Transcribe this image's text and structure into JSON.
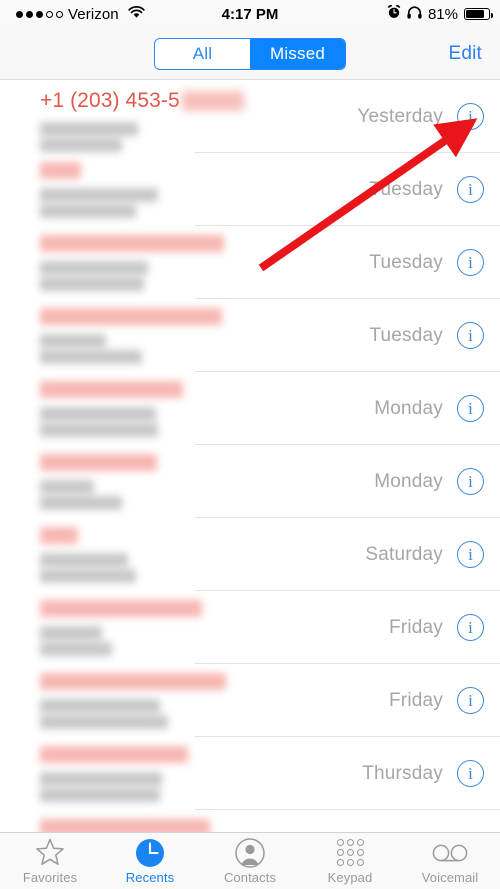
{
  "status_bar": {
    "carrier": "Verizon",
    "signal_dots_filled": 3,
    "signal_dots_total": 5,
    "wifi_icon": "wifi-icon",
    "time": "4:17 PM",
    "alarm_icon": "alarm-clock-icon",
    "headphones_icon": "headphones-icon",
    "battery_percent": "81%",
    "battery_level": 81
  },
  "nav_bar": {
    "segments": [
      {
        "label": "All",
        "selected": false
      },
      {
        "label": "Missed",
        "selected": true
      }
    ],
    "edit_label": "Edit"
  },
  "colors": {
    "accent_blue": "#0b84fe",
    "tint_blue": "#2a88f5",
    "missed_red": "#e2574c",
    "timestamp_gray": "#a6a6a6",
    "arrow_red": "#e8161a",
    "divider": "#e2e2e2",
    "bar_background": "#f8f8f8"
  },
  "annotation": {
    "arrow_icon": "red-arrow-pointing-up-right",
    "color": "#e8161a",
    "points_to": "info-button-row-1"
  },
  "call_list": {
    "rows": [
      {
        "name": "+1 (203) 453-5",
        "name_redacted": true,
        "redacted_name_width": 62,
        "subtitle_redacted_widths": [
          98,
          82
        ],
        "when": "Yesterday",
        "info_icon": "info-icon"
      },
      {
        "name": "",
        "name_redacted": true,
        "redacted_name_widths": [
          41
        ],
        "subtitle_redacted_widths": [
          118,
          96
        ],
        "when": "Tuesday",
        "info_icon": "info-icon"
      },
      {
        "name": "",
        "name_redacted": true,
        "redacted_name_widths": [
          184
        ],
        "subtitle_redacted_widths": [
          108,
          104
        ],
        "when": "Tuesday",
        "info_icon": "info-icon"
      },
      {
        "name": "",
        "name_redacted": true,
        "redacted_name_widths": [
          182
        ],
        "subtitle_redacted_widths": [
          66,
          102
        ],
        "when": "Tuesday",
        "info_icon": "info-icon"
      },
      {
        "name": "",
        "name_redacted": true,
        "redacted_name_widths": [
          143
        ],
        "subtitle_redacted_widths": [
          116,
          118
        ],
        "when": "Monday",
        "info_icon": "info-icon"
      },
      {
        "name": "",
        "name_redacted": true,
        "redacted_name_widths": [
          117
        ],
        "subtitle_redacted_widths": [
          54,
          82
        ],
        "when": "Monday",
        "info_icon": "info-icon"
      },
      {
        "name": "",
        "name_redacted": true,
        "redacted_name_widths": [
          38
        ],
        "subtitle_redacted_widths": [
          88,
          96
        ],
        "when": "Saturday",
        "info_icon": "info-icon"
      },
      {
        "name": "",
        "name_redacted": true,
        "redacted_name_widths": [
          162
        ],
        "subtitle_redacted_widths": [
          62,
          72
        ],
        "when": "Friday",
        "info_icon": "info-icon"
      },
      {
        "name": "",
        "name_redacted": true,
        "redacted_name_widths": [
          186
        ],
        "subtitle_redacted_widths": [
          120,
          128
        ],
        "when": "Friday",
        "info_icon": "info-icon"
      },
      {
        "name": "",
        "name_redacted": true,
        "redacted_name_widths": [
          148
        ],
        "subtitle_redacted_widths": [
          122,
          120
        ],
        "when": "Thursday",
        "info_icon": "info-icon"
      },
      {
        "name": "",
        "name_redacted": true,
        "redacted_name_widths": [
          170
        ],
        "subtitle_redacted_widths": [
          0,
          0
        ],
        "when": "",
        "info_icon": "info-icon",
        "partial": true
      }
    ]
  },
  "tab_bar": {
    "tabs": [
      {
        "label": "Favorites",
        "icon": "star-icon",
        "active": false
      },
      {
        "label": "Recents",
        "icon": "clock-icon",
        "active": true
      },
      {
        "label": "Contacts",
        "icon": "person-icon",
        "active": false
      },
      {
        "label": "Keypad",
        "icon": "keypad-grid-icon",
        "active": false
      },
      {
        "label": "Voicemail",
        "icon": "voicemail-icon",
        "active": false
      }
    ]
  }
}
